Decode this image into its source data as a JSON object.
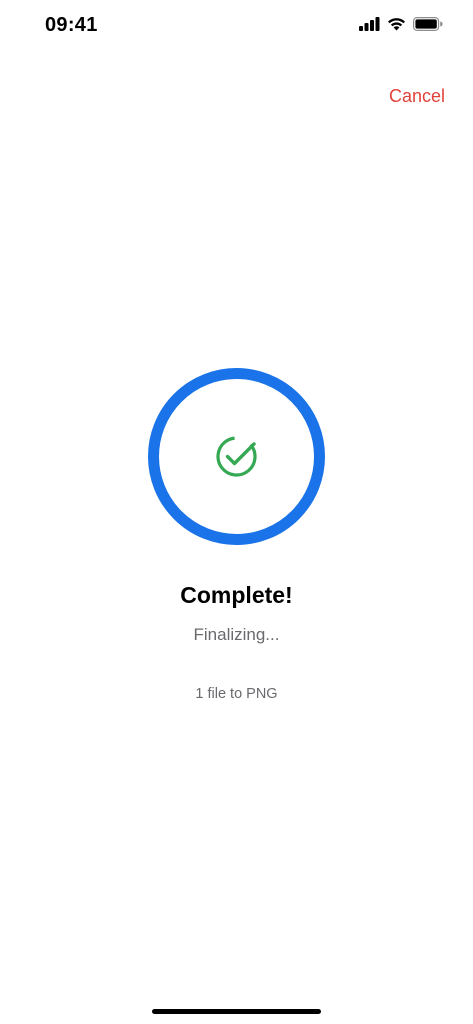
{
  "status_bar": {
    "time": "09:41",
    "icons": [
      "cellular-signal-icon",
      "wifi-icon",
      "battery-icon"
    ]
  },
  "header": {
    "cancel_label": "Cancel",
    "cancel_color": "#e0433a"
  },
  "progress": {
    "value": 1.0,
    "ring_color": "#1a73e8",
    "check_color": "#34a853",
    "icon": "check-circle-icon"
  },
  "content": {
    "title": "Complete!",
    "subtitle": "Finalizing...",
    "detail": "1 file to PNG"
  }
}
